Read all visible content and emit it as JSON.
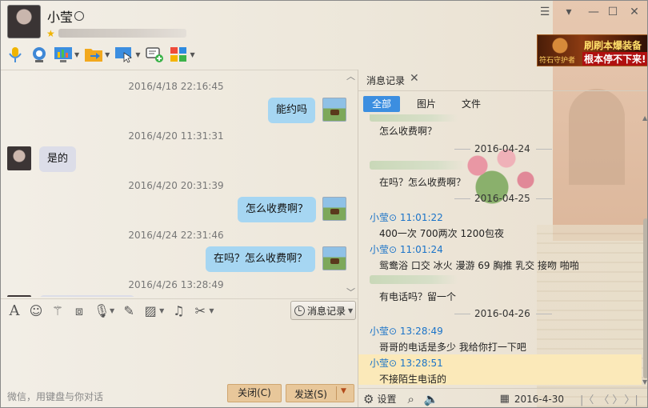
{
  "window": {
    "contact_name": "小莹",
    "controls": {
      "skin": "☰",
      "menu": "▾",
      "minimize": "—",
      "maximize": "☐",
      "close": "✕"
    }
  },
  "toolbar": {
    "items": [
      "voice-call",
      "video-call",
      "remote-screen",
      "file-transfer",
      "share-screen",
      "message-add",
      "apps"
    ]
  },
  "ad": {
    "line1": "刷刷本爆装备",
    "line2": "根本停不下来!",
    "tag": "符石守护者"
  },
  "chat": {
    "messages": [
      {
        "time": "2016/4/18 22:16:45",
        "side": "right",
        "text": "能约吗"
      },
      {
        "time": "2016/4/20 11:31:31",
        "side": "left",
        "text": "是的"
      },
      {
        "time": "2016/4/20 20:31:39",
        "side": "right",
        "text": "怎么收费啊？"
      },
      {
        "time": "2016/4/24 22:31:46",
        "side": "right",
        "text": "在吗？怎么收费啊？"
      },
      {
        "time": "2016/4/26 13:28:49",
        "side": "left",
        "text": ""
      }
    ]
  },
  "input": {
    "history_button": "消息记录",
    "hint": "微信，用键盘与你对话",
    "close_button": "关闭(C)",
    "send_button": "发送(S)"
  },
  "history": {
    "tab_label": "消息记录",
    "filters": [
      "全部",
      "图片",
      "文件"
    ],
    "entries": [
      {
        "type": "msg",
        "text": "怎么收费啊？"
      },
      {
        "type": "date",
        "text": "2016-04-24"
      },
      {
        "type": "msg",
        "text": "在吗？怎么收费啊？"
      },
      {
        "type": "date",
        "text": "2016-04-25"
      },
      {
        "type": "name",
        "text": "小莹⊙ 11:01:22"
      },
      {
        "type": "msg",
        "text": "400一次 700两次 1200包夜"
      },
      {
        "type": "name",
        "text": "小莹⊙ 11:01:24"
      },
      {
        "type": "msg",
        "text": "鸳鸯浴 口交 冰火 漫游 69 胸推 乳交 接吻 啪啪"
      },
      {
        "type": "msg",
        "text": "有电话吗？留一个"
      },
      {
        "type": "date",
        "text": "2016-04-26"
      },
      {
        "type": "name",
        "text": "小莹⊙ 13:28:49"
      },
      {
        "type": "msg",
        "text": "哥哥的电话是多少 我给你打一下吧"
      },
      {
        "type": "name",
        "text": "小莹⊙ 13:28:51"
      },
      {
        "type": "msg",
        "text": "不接陌生电话的"
      }
    ],
    "bottom": {
      "settings_label": "设置",
      "date": "2016-4-30"
    }
  }
}
